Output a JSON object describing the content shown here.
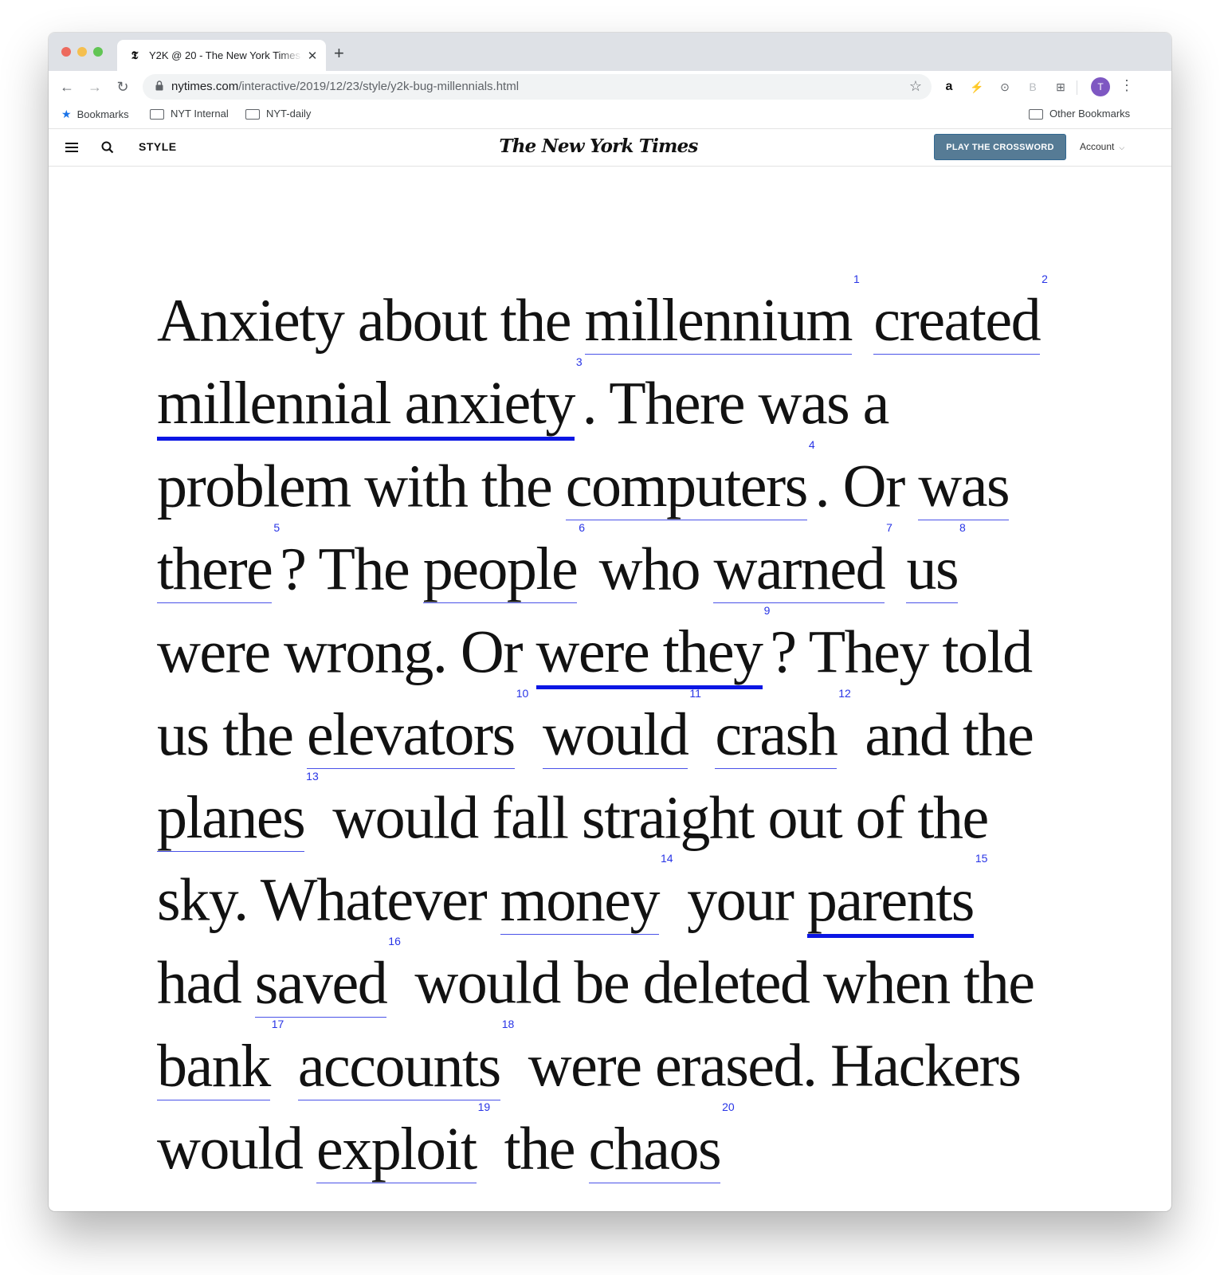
{
  "browser": {
    "tab_title": "Y2K @ 20 - The New York Times",
    "tab_favicon": "𝕿",
    "new_tab_label": "+",
    "close_label": "✕",
    "url_host": "nytimes.com",
    "url_path": "/interactive/2019/12/23/style/y2k-bug-millennials.html",
    "avatar_initial": "T",
    "extensions": [
      "a",
      "⚡",
      "⊙",
      "B",
      "⊞"
    ]
  },
  "bookmarks": {
    "items": [
      "Bookmarks",
      "NYT Internal",
      "NYT-daily"
    ],
    "other": "Other Bookmarks"
  },
  "nyt": {
    "section": "STYLE",
    "masthead": "The New York Times",
    "crossword_label": "PLAY THE CROSSWORD",
    "account_label": "Account"
  },
  "article": {
    "link_color": "#4a52e8",
    "tokens": [
      {
        "t": "Anxiety about the "
      },
      {
        "link": "millennium",
        "fn": "1"
      },
      {
        "t": " "
      },
      {
        "link": "created",
        "fn": "2"
      },
      {
        "t": " "
      },
      {
        "link": "millennial anxiety",
        "fn": "3",
        "hot": true
      },
      {
        "t": ". There was a problem with the "
      },
      {
        "link": "computers",
        "fn": "4"
      },
      {
        "t": ". Or "
      },
      {
        "link": "was there",
        "fn": "5"
      },
      {
        "t": "? The "
      },
      {
        "link": "people",
        "fn": "6"
      },
      {
        "t": " who "
      },
      {
        "link": "warned",
        "fn": "7"
      },
      {
        "t": " "
      },
      {
        "link": "us",
        "fn": "8"
      },
      {
        "t": " were wrong. Or "
      },
      {
        "link": "were they",
        "fn": "9",
        "hot": true
      },
      {
        "t": "? They told us the "
      },
      {
        "link": "elevators",
        "fn": "10"
      },
      {
        "t": " "
      },
      {
        "link": "would",
        "fn": "11"
      },
      {
        "t": " "
      },
      {
        "link": "crash",
        "fn": "12"
      },
      {
        "t": " and the "
      },
      {
        "link": "planes",
        "fn": "13"
      },
      {
        "t": " would fall straight out of the sky. Whatever "
      },
      {
        "link": "money",
        "fn": "14"
      },
      {
        "t": " your "
      },
      {
        "link": "parents",
        "fn": "15",
        "hot": true
      },
      {
        "t": " had "
      },
      {
        "link": "saved",
        "fn": "16"
      },
      {
        "t": " would be deleted when the "
      },
      {
        "link": "bank",
        "fn": "17"
      },
      {
        "t": " "
      },
      {
        "link": "accounts",
        "fn": "18"
      },
      {
        "t": " were erased. Hackers would "
      },
      {
        "link": "exploit",
        "fn": "19"
      },
      {
        "t": " the "
      },
      {
        "link": "chaos",
        "fn": "20"
      }
    ]
  }
}
